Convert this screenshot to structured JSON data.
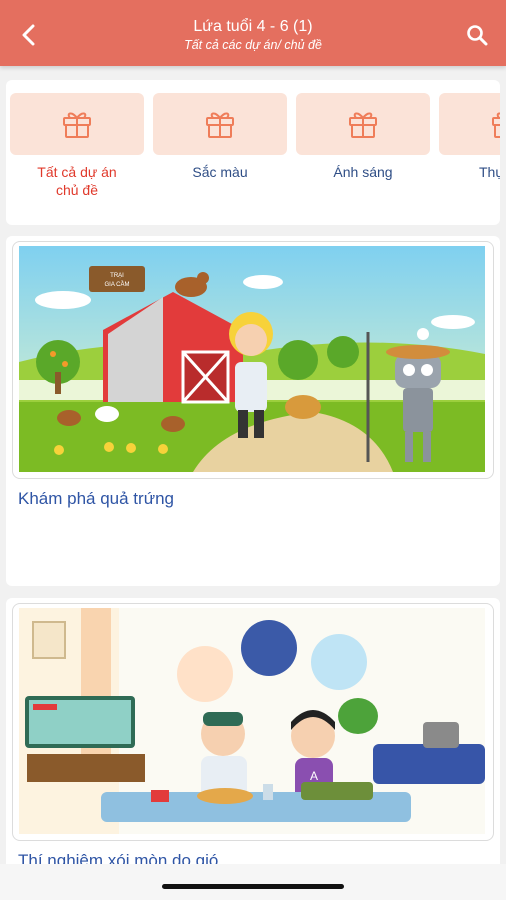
{
  "header": {
    "title": "Lứa tuổi 4 - 6 (1)",
    "subtitle": "Tất cả các dự án/ chủ đề",
    "back_icon": "chevron-left-icon",
    "search_icon": "search-icon"
  },
  "categories": [
    {
      "label": "Tất cả dự án chủ đề",
      "icon": "gift-icon",
      "active": true
    },
    {
      "label": "Sắc màu",
      "icon": "gift-icon",
      "active": false
    },
    {
      "label": "Ánh sáng",
      "icon": "gift-icon",
      "active": false
    },
    {
      "label": "Thự",
      "icon": "gift-icon",
      "active": false
    }
  ],
  "projects": [
    {
      "title": "Khám phá quả trứng",
      "sign_text_1": "TRẠI",
      "sign_text_2": "GIA CẦM"
    },
    {
      "title": "Thí nghiệm xói mòn do gió",
      "sign_text_1": "A",
      "sign_text_2": ""
    }
  ],
  "colors": {
    "header": "#e46f5f",
    "active_category": "#e0392b",
    "category_text": "#2f4e86",
    "card_title": "#2f55a5",
    "category_tile": "#fbe3d8"
  }
}
